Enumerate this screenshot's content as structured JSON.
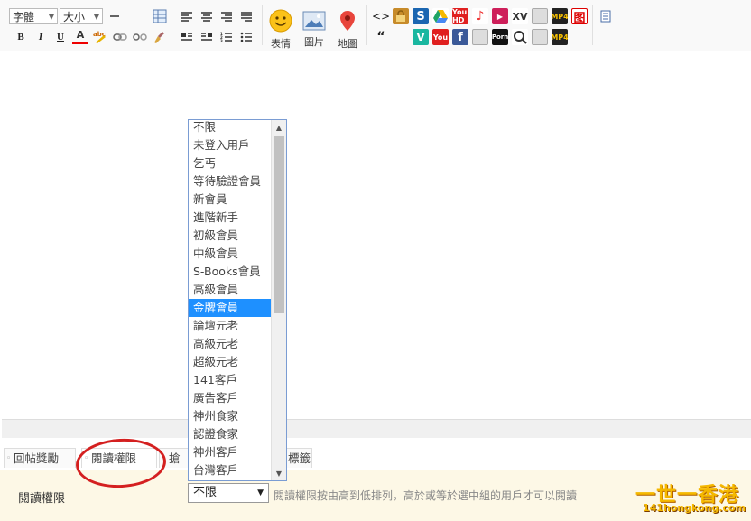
{
  "toolbar": {
    "font_label": "字體",
    "size_label": "大小",
    "emoji_label": "表情",
    "image_label": "圖片",
    "map_label": "地圖",
    "bold": "B",
    "italic": "I",
    "underline": "U",
    "font_color": "A",
    "code_glyph": "<>",
    "quote_glyph": "“",
    "media_labels": {
      "youtube_hd": "You HD",
      "youtube": "You",
      "xv": "XV",
      "mp4": "MP4",
      "porn": "Porn"
    }
  },
  "tabs": [
    {
      "label": "回帖獎勵"
    },
    {
      "label": "閱讀權限"
    },
    {
      "label": "搶"
    },
    {
      "label": "標籤"
    }
  ],
  "permission": {
    "label": "閱讀權限",
    "selected": "不限",
    "hint": "閱讀權限按由高到低排列，高於或等於選中組的用戶才可以閱讀"
  },
  "dropdown": {
    "selected_index": 10,
    "options": [
      "不限",
      "未登入用戶",
      "乞丐",
      "等待驗證會員",
      "新會員",
      "進階新手",
      "初級會員",
      "中級會員",
      "S-Books會員",
      "高級會員",
      "金牌會員",
      "論壇元老",
      "高級元老",
      "超級元老",
      "141客戶",
      "廣告客戶",
      "神州食家",
      "認證食家",
      "神州客戶",
      "台灣客戶"
    ]
  },
  "watermark": {
    "main": "一世一香港",
    "sub": "141hongkong.com"
  },
  "colors": {
    "highlight": "#1e90ff",
    "panel_bg": "#fdf8e6",
    "annotation_circle": "#d42020",
    "logo": "#f5b800"
  }
}
